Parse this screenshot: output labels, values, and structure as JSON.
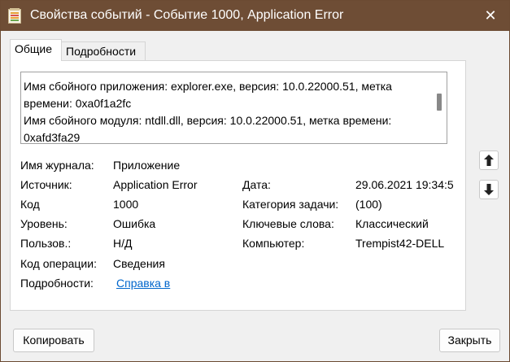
{
  "window": {
    "title": "Свойства событий - Событие 1000, Application Error",
    "close_glyph": "✕"
  },
  "tabs": [
    {
      "label": "Общие",
      "active": true
    },
    {
      "label": "Подробности",
      "active": false
    }
  ],
  "description_lines": [
    "Имя сбойного приложения: explorer.exe, версия: 10.0.22000.51, метка",
    "времени: 0xa0f1a2fc",
    "Имя сбойного модуля: ntdll.dll, версия: 10.0.22000.51, метка времени:",
    "0xafd3fa29"
  ],
  "fields": {
    "log_name": {
      "label": "Имя журнала:",
      "value": "Приложение"
    },
    "source": {
      "label": "Источник:",
      "value": "Application Error"
    },
    "event_id": {
      "label": "Код",
      "value": "1000"
    },
    "level": {
      "label": "Уровень:",
      "value": "Ошибка"
    },
    "user": {
      "label": "Пользов.:",
      "value": "Н/Д"
    },
    "opcode": {
      "label": "Код операции:",
      "value": "Сведения"
    },
    "more_info": {
      "label": "Подробности:",
      "value": "Справка в"
    },
    "date": {
      "label": "Дата:",
      "value": "29.06.2021 19:34:5"
    },
    "task_category": {
      "label": "Категория задачи:",
      "value": "(100)"
    },
    "keywords": {
      "label": "Ключевые слова:",
      "value": "Классический"
    },
    "computer": {
      "label": "Компьютер:",
      "value": "Trempist42-DELL"
    }
  },
  "buttons": {
    "copy": "Копировать",
    "close": "Закрыть"
  },
  "colors": {
    "titlebar": "#6e4d35",
    "link": "#0066cc"
  }
}
